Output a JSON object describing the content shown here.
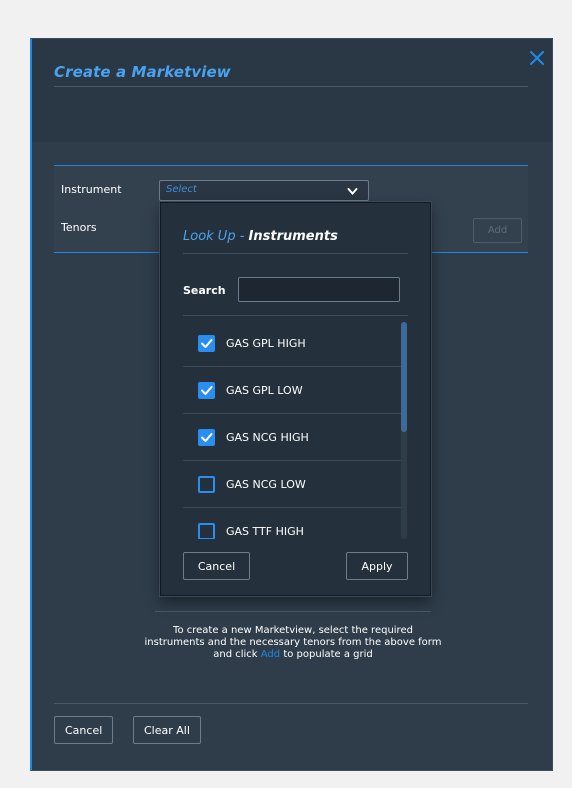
{
  "modal": {
    "title": "Create a Marketview"
  },
  "form": {
    "instrument_label": "Instrument",
    "tenors_label": "Tenors",
    "instrument_placeholder": "Select",
    "add_label": "Add"
  },
  "info": {
    "text_before": "To create a new Marketview, select the required instruments and the necessary tenors from the above form and click ",
    "link": "Add",
    "text_after": " to populate a grid"
  },
  "footer": {
    "cancel_label": "Cancel",
    "clear_label": "Clear All"
  },
  "lookup": {
    "title_prefix": "Look Up",
    "title_sep": " - ",
    "title_name": "Instruments",
    "search_label": "Search",
    "search_value": "",
    "items": [
      {
        "label": "GAS GPL HIGH",
        "checked": true
      },
      {
        "label": "GAS GPL LOW",
        "checked": true
      },
      {
        "label": "GAS NCG HIGH",
        "checked": true
      },
      {
        "label": "GAS NCG LOW",
        "checked": false
      },
      {
        "label": "GAS TTF HIGH",
        "checked": false
      }
    ],
    "cancel_label": "Cancel",
    "apply_label": "Apply"
  },
  "colors": {
    "accent": "#1e87e8",
    "background": "#2f3d4b",
    "header": "#2a3744",
    "popup": "#24313d"
  }
}
